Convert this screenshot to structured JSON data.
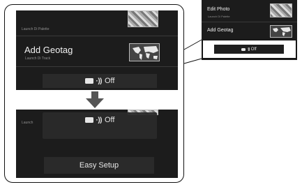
{
  "top_screen": {
    "row1": {
      "sub": "Launch Di Palette"
    },
    "row2": {
      "title": "Add Geotag",
      "sub": "Launch Di Track"
    },
    "off_button": {
      "label": "Off"
    }
  },
  "bottom_screen": {
    "row1": {
      "sub": "Launch"
    },
    "off_button": {
      "label": "Off"
    },
    "easy_setup": {
      "label": "Easy Setup"
    }
  },
  "right_screen": {
    "row1": {
      "title": "Edit Photo",
      "sub": "Launch Di Palette"
    },
    "row2": {
      "title": "Add Geotag"
    },
    "off_button": {
      "label": "Off"
    }
  },
  "icons": [
    "camera-icon",
    "wireless-waves-icon",
    "arrow-down-icon",
    "photo-thumbnail",
    "world-map-thumbnail"
  ]
}
